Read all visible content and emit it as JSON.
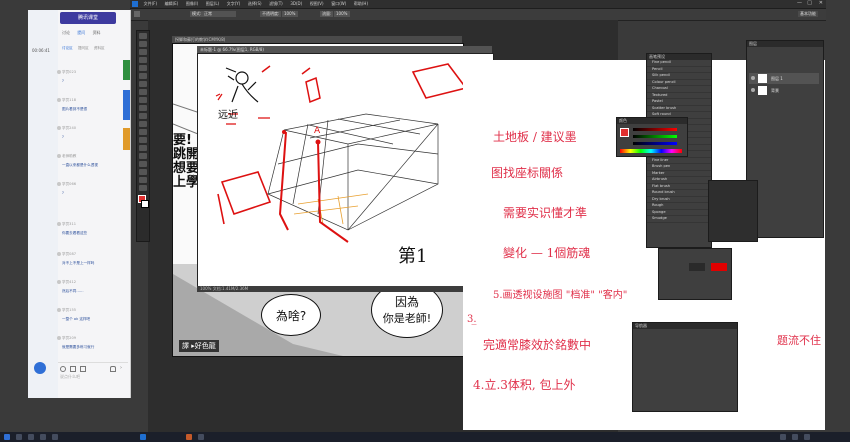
{
  "ps": {
    "menu": [
      "文件(F)",
      "编辑(E)",
      "图像(I)",
      "图层(L)",
      "文字(Y)",
      "选择(S)",
      "滤镜(T)",
      "3D(D)",
      "视图(V)",
      "窗口(W)",
      "帮助(H)"
    ],
    "options": {
      "mode": "正常",
      "opacity": "100%",
      "flow": "100%",
      "right_badge": "基本功能"
    },
    "doc_back_title": "拐脚和蘇打的教学(CMYK/8)",
    "doc_front_title": "未标题-1 @ 66.7%(图层1, RGB/8)",
    "doc_front_status": "100%   文档:1.41M/2.36M",
    "brush_panel_title": "画笔预设",
    "brushes": [
      "Fine pencil",
      "Pencil",
      "Silk pencil",
      "Colour pencil",
      "Charcoal",
      "Textured",
      "Pastel",
      "Scatter brush",
      "Soft round",
      "Hard round",
      "Spatter",
      "Chalk",
      "Watercolor",
      "Wet edge",
      "Inking pen",
      "Fine liner",
      "Brush pen",
      "Marker",
      "Airbrush",
      "Flat brush",
      "Round brush",
      "Dry brush",
      "Rough",
      "Sponge",
      "Smudge"
    ],
    "color_panel_title": "颜色",
    "layers_panel_title": "图层",
    "layers": [
      "图层 1",
      "背景"
    ],
    "small_panel_title": "导航器"
  },
  "chat": {
    "brand": "腾讯课堂",
    "time": "00:06:41",
    "tabs": [
      "讨论",
      "提问",
      "资料"
    ],
    "header_tabs": [
      "讨论区",
      "提问区",
      "资料区"
    ],
    "messages": [
      {
        "name": "学员023",
        "text": "?"
      },
      {
        "name": "学员118",
        "text": "图片看到不是很"
      },
      {
        "name": "学员240",
        "text": "?"
      },
      {
        "name": "老师助教",
        "text": "一直以来都是什么透视"
      },
      {
        "name": "学员066",
        "text": "?"
      },
      {
        "name": "学员311",
        "text": "你要去看看这些"
      },
      {
        "name": "学员087",
        "text": "对不上不是上一样吗"
      },
      {
        "name": "学员412",
        "text": "然后不同……"
      },
      {
        "name": "学员155",
        "text": "一整个 ok 这样吧"
      },
      {
        "name": "学员209",
        "text": "就是需要多练习就行"
      }
    ],
    "input_placeholder": "说点什么吧"
  },
  "sketch": {
    "label_a": "A",
    "label_top": "远近",
    "label_bottom": "第1"
  },
  "manga": {
    "bubble_left": "為啥?",
    "bubble_right_1": "因為",
    "bubble_right_2": "你是老師!",
    "side_text_1": "要!",
    "side_text_2": "跳開學",
    "side_text_3": "想要",
    "side_text_4": "上學!",
    "stamp": "譯 ▸好色龍"
  },
  "notes": [
    "土地板 / 建议墨",
    "图找座标關係",
    "需要实识懂才準",
    "變化 — 1個筋魂",
    "5.画透视设施图  \"档准\" \"客内\"",
    "3.̲",
    "完適常膝效於銘數中",
    "4.立.3体积, 包上外",
    "题流不住"
  ],
  "colors": {
    "accent_red": "#e0304a",
    "ps_dark": "#2f2f2f",
    "taskbar": "#1b1f2a",
    "fg_swatch": "#e03030",
    "bg_swatch": "#ffffff"
  }
}
